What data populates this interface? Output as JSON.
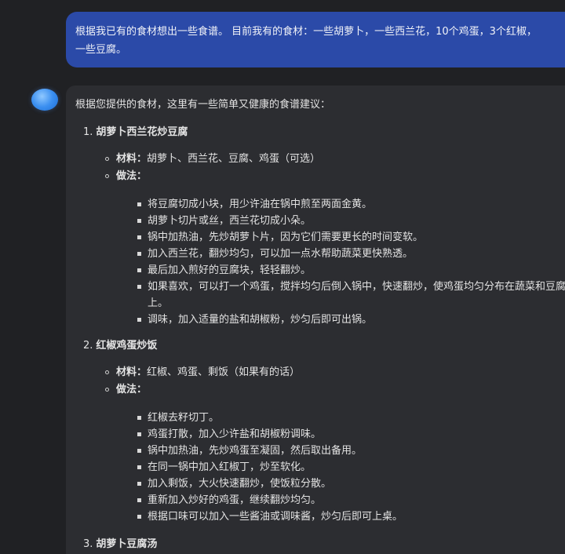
{
  "user_message": "根据我已有的食材想出一些食谱。 目前我有的食材：一些胡萝卜，一些西兰花，10个鸡蛋，3个红椒，一些豆腐。",
  "assistant": {
    "intro": "根据您提供的食材，这里有一些简单又健康的食谱建议：",
    "recipes": [
      {
        "number": "1.",
        "title": "胡萝卜西兰花炒豆腐",
        "ingredients_label": "材料：",
        "ingredients": "胡萝卜、西兰花、豆腐、鸡蛋（可选）",
        "method_label": "做法：",
        "steps": [
          "将豆腐切成小块，用少许油在锅中煎至两面金黄。",
          "胡萝卜切片或丝，西兰花切成小朵。",
          "锅中加热油，先炒胡萝卜片，因为它们需要更长的时间变软。",
          "加入西兰花，翻炒均匀，可以加一点水帮助蔬菜更快熟透。",
          "最后加入煎好的豆腐块，轻轻翻炒。",
          "如果喜欢，可以打一个鸡蛋，搅拌均匀后倒入锅中，快速翻炒，使鸡蛋均匀分布在蔬菜和豆腐上。",
          "调味，加入适量的盐和胡椒粉，炒匀后即可出锅。"
        ]
      },
      {
        "number": "2.",
        "title": "红椒鸡蛋炒饭",
        "ingredients_label": "材料：",
        "ingredients": "红椒、鸡蛋、剩饭（如果有的话）",
        "method_label": "做法：",
        "steps": [
          "红椒去籽切丁。",
          "鸡蛋打散，加入少许盐和胡椒粉调味。",
          "锅中加热油，先炒鸡蛋至凝固，然后取出备用。",
          "在同一锅中加入红椒丁，炒至软化。",
          "加入剩饭，大火快速翻炒，使饭粒分散。",
          "重新加入炒好的鸡蛋，继续翻炒均匀。",
          "根据口味可以加入一些酱油或调味酱，炒匀后即可上桌。"
        ]
      },
      {
        "number": "3.",
        "title": "胡萝卜豆腐汤"
      }
    ]
  }
}
